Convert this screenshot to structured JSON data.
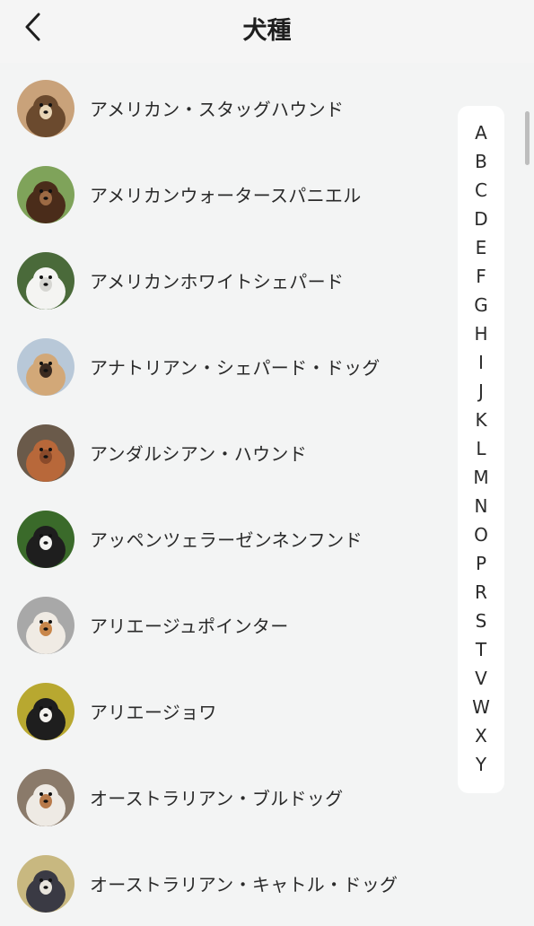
{
  "header": {
    "title": "犬種",
    "back_icon": "chevron-left-icon"
  },
  "breeds": [
    {
      "name": "アメリカン・スタッグハウンド",
      "colors": [
        "#c9a27a",
        "#6b4a2e",
        "#e8d5b5"
      ]
    },
    {
      "name": "アメリカンウォータースパニエル",
      "colors": [
        "#7fa35a",
        "#4a2c1a",
        "#9c6a44"
      ]
    },
    {
      "name": "アメリカンホワイトシェパード",
      "colors": [
        "#4a6a3a",
        "#f4f4f2",
        "#d6d6d2"
      ]
    },
    {
      "name": "アナトリアン・シェパード・ドッグ",
      "colors": [
        "#b8c8d8",
        "#d2a878",
        "#3a2a20"
      ]
    },
    {
      "name": "アンダルシアン・ハウンド",
      "colors": [
        "#6a5a4a",
        "#b8683a",
        "#8a4a2a"
      ]
    },
    {
      "name": "アッペンツェラーゼンネンフンド",
      "colors": [
        "#3a6a2a",
        "#1e1e1e",
        "#f2f2f0"
      ]
    },
    {
      "name": "アリエージュポインター",
      "colors": [
        "#a8a8a8",
        "#f0ebe4",
        "#c8864a"
      ]
    },
    {
      "name": "アリエージョワ",
      "colors": [
        "#b8a830",
        "#1e1e1e",
        "#f4f2ee"
      ]
    },
    {
      "name": "オーストラリアン・ブルドッグ",
      "colors": [
        "#8a7a6a",
        "#eeeae4",
        "#b87a4a"
      ]
    },
    {
      "name": "オーストラリアン・キャトル・ドッグ",
      "colors": [
        "#c8b880",
        "#3a3a44",
        "#e8e4dc"
      ]
    }
  ],
  "index": [
    "A",
    "B",
    "C",
    "D",
    "E",
    "F",
    "G",
    "H",
    "I",
    "J",
    "K",
    "L",
    "M",
    "N",
    "O",
    "P",
    "R",
    "S",
    "T",
    "V",
    "W",
    "X",
    "Y"
  ]
}
